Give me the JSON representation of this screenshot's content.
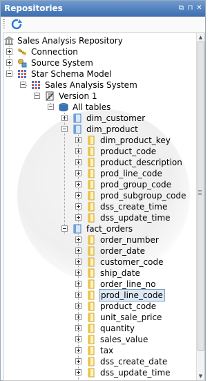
{
  "panel": {
    "title": "Repositories",
    "controls": [
      "⧉",
      "⊓",
      "✕"
    ]
  },
  "toolbar": {
    "refresh_icon": "refresh-icon"
  },
  "tree": {
    "root": "Sales Analysis Repository",
    "connection": "Connection",
    "source_system": "Source System",
    "star_schema_model": "Star Schema Model",
    "sales_analysis_system": "Sales Analysis System",
    "version": "Version 1",
    "all_tables": "All tables",
    "dim_customer": "dim_customer",
    "dim_product": {
      "label": "dim_product",
      "columns": [
        "dim_product_key",
        "product_code",
        "product_description",
        "prod_line_code",
        "prod_group_code",
        "prod_subgroup_code",
        "dss_create_time",
        "dss_update_time"
      ]
    },
    "fact_orders": {
      "label": "fact_orders",
      "columns": [
        "order_number",
        "order_date",
        "customer_code",
        "ship_date",
        "order_line_no",
        "prod_line_code",
        "product_code",
        "unit_sale_price",
        "quantity",
        "sales_value",
        "tax",
        "dss_create_date",
        "dss_update_time"
      ]
    },
    "selected": "prod_line_code"
  },
  "colors": {
    "title_bar": "#3d6fb0",
    "selection": "#dce8f7",
    "selection_border": "#7f9db9"
  }
}
